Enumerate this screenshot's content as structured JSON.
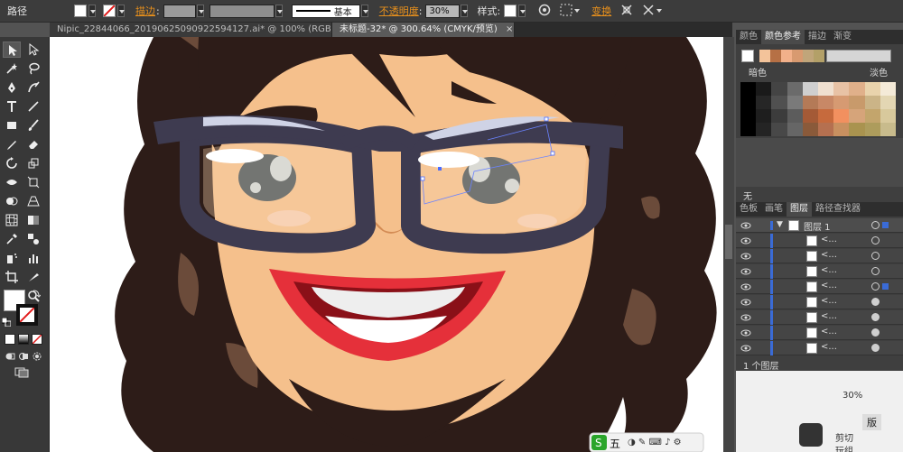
{
  "control_bar": {
    "object_type": "路径",
    "stroke_label": "描边",
    "stroke_style": "基本",
    "opacity_label": "不透明度",
    "opacity_value": "30%",
    "style_label": "样式",
    "transform_label": "变换"
  },
  "tabs": [
    {
      "label": "Nipic_22844066_20190625090922594127.ai* @ 100% (RGB/预览)"
    },
    {
      "label": "未标题-32* @ 300.64% (CMYK/预览)"
    }
  ],
  "tab_close": "×",
  "color_panel": {
    "tabs": [
      "颜色",
      "颜色参考",
      "描边",
      "渐变"
    ],
    "active_tab": "颜色参考",
    "dark_label": "暗色",
    "light_label": "淡色",
    "none_label": "无",
    "harmony_colors": [
      "#f3c39a",
      "#b67045",
      "#f2b08a",
      "#d89a70",
      "#c0a57a",
      "#b3a068"
    ],
    "grid_colors": [
      [
        "#000000",
        "#1a1a1a",
        "#444444",
        "#6b6b6b",
        "#cfcfcf",
        "#f0e0d0",
        "#e8c2a5",
        "#e0b08a",
        "#e9d3ac",
        "#f4ead8"
      ],
      [
        "#000000",
        "#262626",
        "#505050",
        "#7a7a7a",
        "#b47a57",
        "#c88866",
        "#d69a72",
        "#c89a6b",
        "#cbb487",
        "#e3d6b3"
      ],
      [
        "#000000",
        "#1e1e1e",
        "#3c3c3c",
        "#5c5c5c",
        "#a45a36",
        "#c66a3d",
        "#f2905f",
        "#d6a47a",
        "#c3a56c",
        "#d8c99c"
      ],
      [
        "#000000",
        "#242424",
        "#484848",
        "#666666",
        "#8a5a3a",
        "#b57050",
        "#c89060",
        "#a9934f",
        "#ad9c5c",
        "#c8bb8c"
      ]
    ]
  },
  "layers_panel": {
    "tabs": [
      "色板",
      "画笔",
      "图层",
      "路径查找器"
    ],
    "active_tab": "图层",
    "top_layer_name": "图层 1",
    "sublayer_name": "<...",
    "rows": 8,
    "footer_text": "1 个图层"
  },
  "ime_bar": {
    "label": "五"
  },
  "bottom_panel": {
    "item1": "剪切",
    "item2": "玩组",
    "item3": "版",
    "opacity": "30%"
  }
}
